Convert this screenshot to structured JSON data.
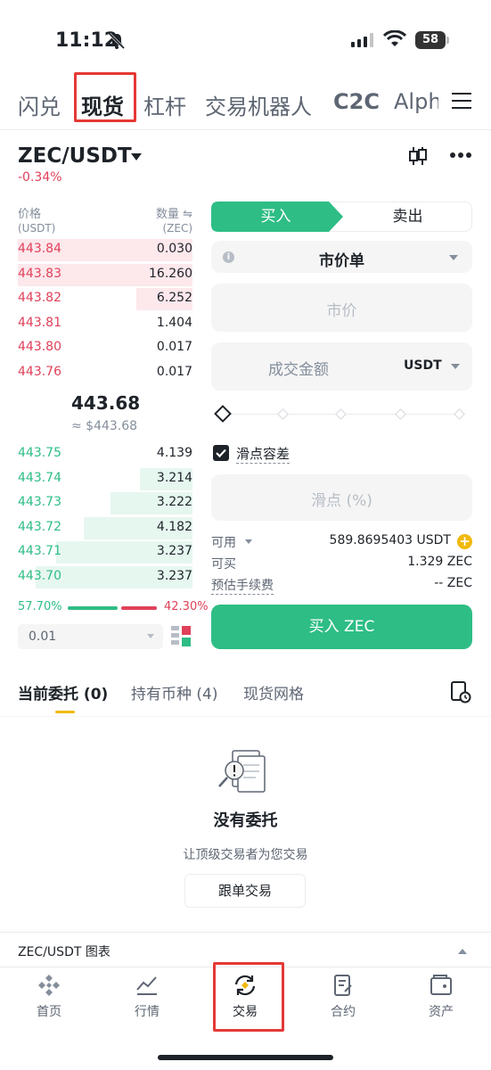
{
  "status_bar": {
    "time": "11:12",
    "battery": "58"
  },
  "top_tabs": [
    {
      "label": "闪兑"
    },
    {
      "label": "现货"
    },
    {
      "label": "杠杆"
    },
    {
      "label": "交易机器人"
    },
    {
      "label": "C2C"
    },
    {
      "label": "Alph"
    }
  ],
  "pair": {
    "symbol": "ZEC/USDT",
    "change": "-0.34%"
  },
  "order_book": {
    "price_header": "价格",
    "price_unit": "(USDT)",
    "qty_header": "数量 ⇋",
    "qty_unit": "(ZEC)",
    "asks": [
      {
        "price": "443.84",
        "qty": "0.030",
        "depth": 1.0
      },
      {
        "price": "443.83",
        "qty": "16.260",
        "depth": 1.0
      },
      {
        "price": "443.82",
        "qty": "6.252",
        "depth": 0.32
      },
      {
        "price": "443.81",
        "qty": "1.404",
        "depth": 0
      },
      {
        "price": "443.80",
        "qty": "0.017",
        "depth": 0
      },
      {
        "price": "443.76",
        "qty": "0.017",
        "depth": 0
      }
    ],
    "last_price": "443.68",
    "last_price_usd": "≈ $443.68",
    "bids": [
      {
        "price": "443.75",
        "qty": "4.139",
        "depth": 0
      },
      {
        "price": "443.74",
        "qty": "3.214",
        "depth": 0.3
      },
      {
        "price": "443.73",
        "qty": "3.222",
        "depth": 0.47
      },
      {
        "price": "443.72",
        "qty": "4.182",
        "depth": 0.62
      },
      {
        "price": "443.71",
        "qty": "3.237",
        "depth": 0.78
      },
      {
        "price": "443.70",
        "qty": "3.237",
        "depth": 0.9
      }
    ],
    "buy_ratio": "57.70%",
    "sell_ratio": "42.30%",
    "buy_ratio_value": 0.577,
    "precision": "0.01"
  },
  "trade_form": {
    "buy_tab": "买入",
    "sell_tab": "卖出",
    "order_type": "市价单",
    "price_placeholder": "市价",
    "amount_placeholder": "成交金额",
    "amount_unit": "USDT",
    "slippage_label": "滑点容差",
    "slippage_placeholder": "滑点 (%)",
    "available_label": "可用",
    "available_value": "589.8695403 USDT",
    "can_buy_label": "可买",
    "can_buy_value": "1.329 ZEC",
    "fee_label": "预估手续费",
    "fee_value": "-- ZEC",
    "submit": "买入 ZEC"
  },
  "orders": {
    "tabs": [
      {
        "label": "当前委托 (0)"
      },
      {
        "label": "持有币种 (4)"
      },
      {
        "label": "现货网格"
      }
    ],
    "empty_title": "没有委托",
    "empty_subtitle": "让顶级交易者为您交易",
    "copy_trade_button": "跟单交易"
  },
  "chart_bar": {
    "label": "ZEC/USDT 图表"
  },
  "bottom_nav": [
    {
      "label": "首页",
      "icon": "home-icon"
    },
    {
      "label": "行情",
      "icon": "market-icon"
    },
    {
      "label": "交易",
      "icon": "trade-icon"
    },
    {
      "label": "合约",
      "icon": "futures-icon"
    },
    {
      "label": "资产",
      "icon": "wallet-icon"
    }
  ],
  "colors": {
    "buy": "#2ebd85",
    "sell": "#e0415a",
    "accent": "#f0b90b",
    "highlight": "#e53935"
  }
}
